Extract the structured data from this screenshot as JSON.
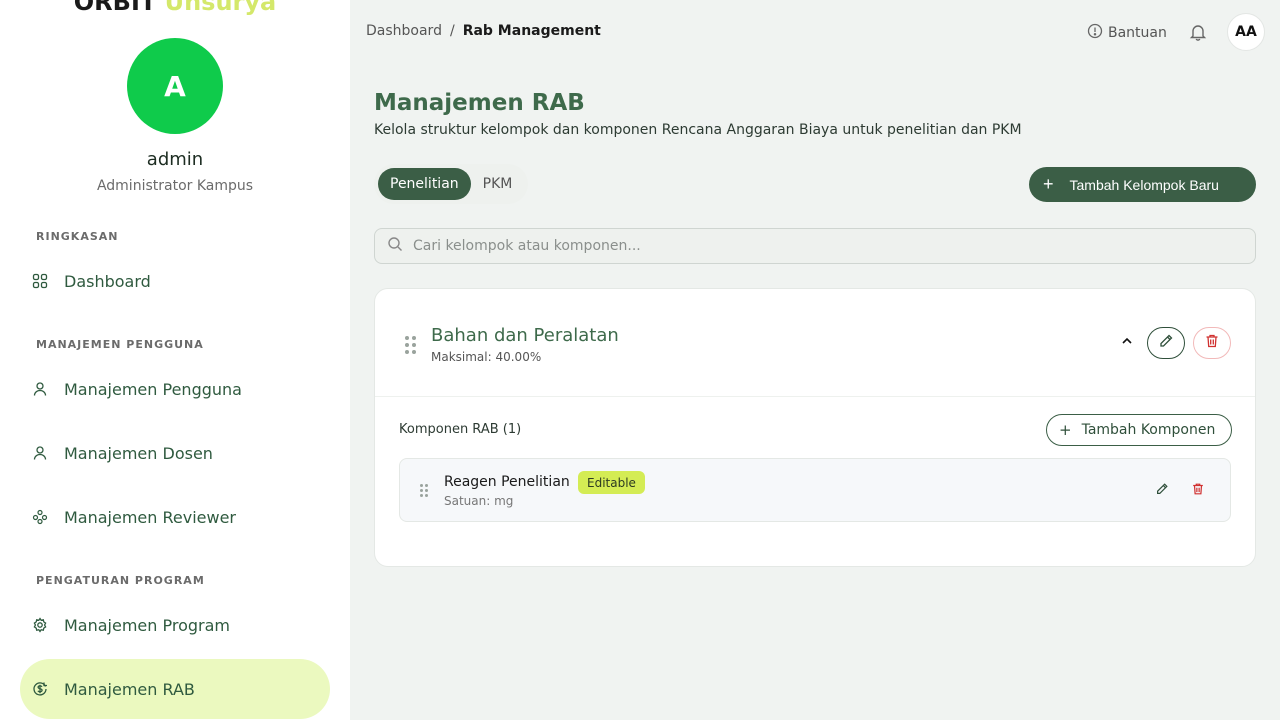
{
  "brand": {
    "part1": "ORBIT",
    "part2": "Unsurya"
  },
  "user": {
    "initial": "A",
    "name": "admin",
    "role": "Administrator Kampus"
  },
  "sidebar": {
    "sections": [
      {
        "label": "RINGKASAN",
        "items": [
          {
            "label": "Dashboard",
            "icon": "grid-icon"
          }
        ]
      },
      {
        "label": "MANAJEMEN PENGGUNA",
        "items": [
          {
            "label": "Manajemen Pengguna",
            "icon": "user-icon"
          },
          {
            "label": "Manajemen Dosen",
            "icon": "user-icon"
          },
          {
            "label": "Manajemen Reviewer",
            "icon": "users-icon"
          }
        ]
      },
      {
        "label": "PENGATURAN PROGRAM",
        "items": [
          {
            "label": "Manajemen Program",
            "icon": "gear-icon"
          },
          {
            "label": "Manajemen RAB",
            "icon": "money-icon",
            "active": true
          }
        ]
      }
    ]
  },
  "header": {
    "breadcrumb": [
      "Dashboard",
      "/",
      "Rab Management"
    ],
    "help_label": "Bantuan",
    "avatar_initials": "AA"
  },
  "main": {
    "title": "Manajemen RAB",
    "subtitle": "Kelola struktur kelompok dan komponen Rencana Anggaran Biaya untuk penelitian dan PKM",
    "tabs": [
      {
        "label": "Penelitian",
        "active": true
      },
      {
        "label": "PKM",
        "active": false
      }
    ],
    "add_group_label": "Tambah Kelompok Baru",
    "search_placeholder": "Cari kelompok atau komponen...",
    "group": {
      "title": "Bahan dan Peralatan",
      "max": "Maksimal: 40.00%",
      "components_title": "Komponen RAB (1)",
      "add_component_label": "Tambah Komponen",
      "components": [
        {
          "name": "Reagen Penelitian",
          "badge": "Editable",
          "unit": "Satuan: mg"
        }
      ]
    }
  },
  "colors": {
    "primary": "#3b5e46",
    "accent": "#d4ec54",
    "active_nav": "#ebf9bf",
    "avatar": "#0fcb4b",
    "danger": "#d0302f"
  }
}
